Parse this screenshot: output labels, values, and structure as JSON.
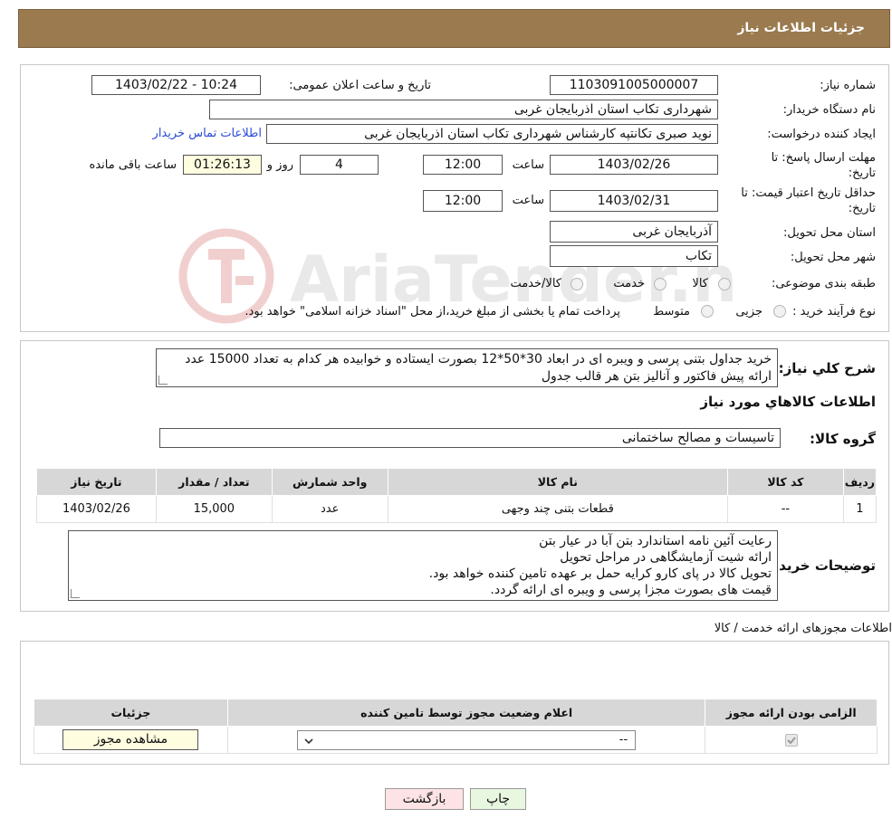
{
  "header": {
    "title": "جزئیات اطلاعات نیاز"
  },
  "form": {
    "need_number": {
      "label": "شماره نیاز:",
      "value": "1103091005000007"
    },
    "announce_datetime": {
      "label": "تاریخ و ساعت اعلان عمومی:",
      "value": "1403/02/22 - 10:24"
    },
    "buyer_org": {
      "label": "نام دستگاه خریدار:",
      "value": "شهرداری تکاب استان اذربایجان غربی"
    },
    "requester": {
      "label": "ایجاد کننده درخواست:",
      "value": "نوید صبری تکانتپه کارشناس شهرداری تکاب استان اذربایجان غربی"
    },
    "buyer_contact_link": "اطلاعات تماس خریدار",
    "reply_deadline": {
      "label_line1": "مهلت ارسال پاسخ: تا",
      "label_line2": "تاریخ:",
      "date": "1403/02/26",
      "time_label": "ساعت",
      "time": "12:00",
      "days": "4",
      "days_label": "روز و",
      "remaining": "01:26:13",
      "remaining_label": "ساعت باقی مانده"
    },
    "price_validity": {
      "label_line1": "حداقل تاریخ اعتبار قیمت: تا",
      "label_line2": "تاریخ:",
      "date": "1403/02/31",
      "time_label": "ساعت",
      "time": "12:00"
    },
    "province": {
      "label": "استان محل تحویل:",
      "value": "آذربایجان غربی"
    },
    "city": {
      "label": "شهر محل تحویل:",
      "value": "تکاب"
    },
    "category": {
      "label": "طبقه بندی موضوعی:",
      "options": [
        "کالا",
        "خدمت",
        "کالا/خدمت"
      ]
    },
    "purchase_type": {
      "label": "نوع فرآیند خرید :",
      "options": [
        "جزیی",
        "متوسط"
      ],
      "note": "پرداخت تمام یا بخشی از مبلغ خرید،از محل \"اسناد خزانه اسلامی\" خواهد بود."
    }
  },
  "watermark_text": "AriaTender.neT",
  "description": {
    "label": "شرح کلي نياز:",
    "lines": [
      "خرید جداول بتنی پرسی و ویبره ای در ابعاد 30*50*12 بصورت ایستاده و خوابیده هر کدام به تعداد 15000 عدد",
      "ارائه پیش فاکتور و آنالیز بتن هر قالب جدول"
    ]
  },
  "goods_info": {
    "title": "اطلاعات کالاهاي مورد نياز",
    "group_label": "گروه کالا:",
    "group_value": "تاسیسات و مصالح ساختمانی",
    "table": {
      "headers": [
        "ردیف",
        "کد کالا",
        "نام کالا",
        "واحد شمارش",
        "تعداد / مقدار",
        "تاریخ نیاز"
      ],
      "rows": [
        [
          "1",
          "--",
          "قطعات بتنی چند وجهی",
          "عدد",
          "15,000",
          "1403/02/26"
        ]
      ]
    },
    "buyer_notes_label": "توضیحات خریدار:",
    "buyer_notes": [
      "رعایت آئین نامه استاندارد بتن آبا در عیار بتن",
      "ارائه شیت آزمایشگاهی در مراحل تحویل",
      "تحویل کالا در پای کارو کرایه حمل بر عهده تامین کننده خواهد بود.",
      "قیمت های بصورت مجزا پرسی و ویبره ای ارائه گردد."
    ]
  },
  "permits": {
    "title": "اطلاعات مجوزهای ارائه خدمت / کالا",
    "headers": [
      "الزامی بودن ارائه مجوز",
      "اعلام وضعیت مجوز توسط تامین کننده",
      "جزئیات"
    ],
    "select_value": "--",
    "view_button": "مشاهده مجوز"
  },
  "buttons": {
    "print": "چاپ",
    "back": "بازگشت"
  },
  "colors": {
    "header_bg": "#9a7a4e",
    "back_button_bg": "#fde3e3",
    "print_button_bg": "#e8f7e0",
    "watermark": "#c62828"
  }
}
